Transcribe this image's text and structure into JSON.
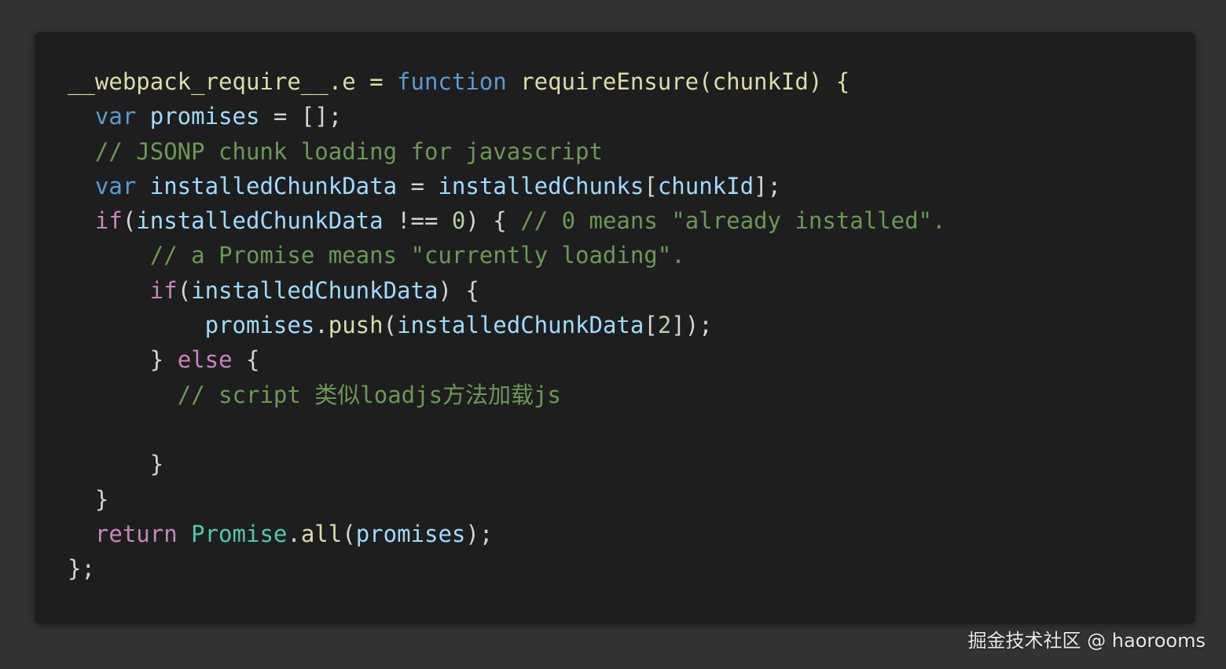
{
  "code": {
    "lines": [
      {
        "tokens": [
          {
            "text": "__webpack_require__.e = ",
            "kind": "fn"
          },
          {
            "text": "function ",
            "kind": "kw-blue"
          },
          {
            "text": "requireEnsure(chunkId) {",
            "kind": "fn"
          }
        ]
      },
      {
        "tokens": [
          {
            "text": "  "
          },
          {
            "text": "var ",
            "kind": "kw-blue"
          },
          {
            "text": "promises",
            "kind": "ident"
          },
          {
            "text": " = [];",
            "kind": "punct"
          }
        ]
      },
      {
        "tokens": [
          {
            "text": "  "
          },
          {
            "text": "// JSONP chunk loading for javascript",
            "kind": "comment"
          }
        ]
      },
      {
        "tokens": [
          {
            "text": "  "
          },
          {
            "text": "var ",
            "kind": "kw-blue"
          },
          {
            "text": "installedChunkData",
            "kind": "ident"
          },
          {
            "text": " = ",
            "kind": "punct"
          },
          {
            "text": "installedChunks",
            "kind": "ident"
          },
          {
            "text": "[",
            "kind": "punct"
          },
          {
            "text": "chunkId",
            "kind": "ident"
          },
          {
            "text": "];",
            "kind": "punct"
          }
        ]
      },
      {
        "tokens": [
          {
            "text": "  "
          },
          {
            "text": "if",
            "kind": "kw-purple"
          },
          {
            "text": "(",
            "kind": "punct"
          },
          {
            "text": "installedChunkData",
            "kind": "ident"
          },
          {
            "text": " !== ",
            "kind": "punct"
          },
          {
            "text": "0",
            "kind": "num"
          },
          {
            "text": ") { ",
            "kind": "punct"
          },
          {
            "text": "// 0 means \"already installed\".",
            "kind": "comment"
          }
        ]
      },
      {
        "tokens": [
          {
            "text": "      "
          },
          {
            "text": "// a Promise means \"currently loading\".",
            "kind": "comment"
          }
        ]
      },
      {
        "tokens": [
          {
            "text": "      "
          },
          {
            "text": "if",
            "kind": "kw-purple"
          },
          {
            "text": "(",
            "kind": "punct"
          },
          {
            "text": "installedChunkData",
            "kind": "ident"
          },
          {
            "text": ") {",
            "kind": "punct"
          }
        ]
      },
      {
        "tokens": [
          {
            "text": "          "
          },
          {
            "text": "promises",
            "kind": "ident"
          },
          {
            "text": ".",
            "kind": "punct"
          },
          {
            "text": "push",
            "kind": "fn"
          },
          {
            "text": "(",
            "kind": "punct"
          },
          {
            "text": "installedChunkData",
            "kind": "ident"
          },
          {
            "text": "[",
            "kind": "punct"
          },
          {
            "text": "2",
            "kind": "num"
          },
          {
            "text": "]);",
            "kind": "punct"
          }
        ]
      },
      {
        "tokens": [
          {
            "text": "      "
          },
          {
            "text": "} ",
            "kind": "punct"
          },
          {
            "text": "else",
            "kind": "kw-purple"
          },
          {
            "text": " {",
            "kind": "punct"
          }
        ]
      },
      {
        "tokens": [
          {
            "text": "        "
          },
          {
            "text": "// script 类似loadjs方法加载js",
            "kind": "comment"
          }
        ]
      },
      {
        "tokens": [
          {
            "text": ""
          }
        ]
      },
      {
        "tokens": [
          {
            "text": "      "
          },
          {
            "text": "}",
            "kind": "punct"
          }
        ]
      },
      {
        "tokens": [
          {
            "text": "  "
          },
          {
            "text": "}",
            "kind": "punct"
          }
        ]
      },
      {
        "tokens": [
          {
            "text": "  "
          },
          {
            "text": "return ",
            "kind": "kw-purple"
          },
          {
            "text": "Promise",
            "kind": "type"
          },
          {
            "text": ".",
            "kind": "punct"
          },
          {
            "text": "all",
            "kind": "fn"
          },
          {
            "text": "(",
            "kind": "punct"
          },
          {
            "text": "promises",
            "kind": "ident"
          },
          {
            "text": ");",
            "kind": "punct"
          }
        ]
      },
      {
        "tokens": [
          {
            "text": "};",
            "kind": "punct"
          }
        ]
      }
    ]
  },
  "watermark": {
    "text": "掘金技术社区 @ haorooms"
  }
}
